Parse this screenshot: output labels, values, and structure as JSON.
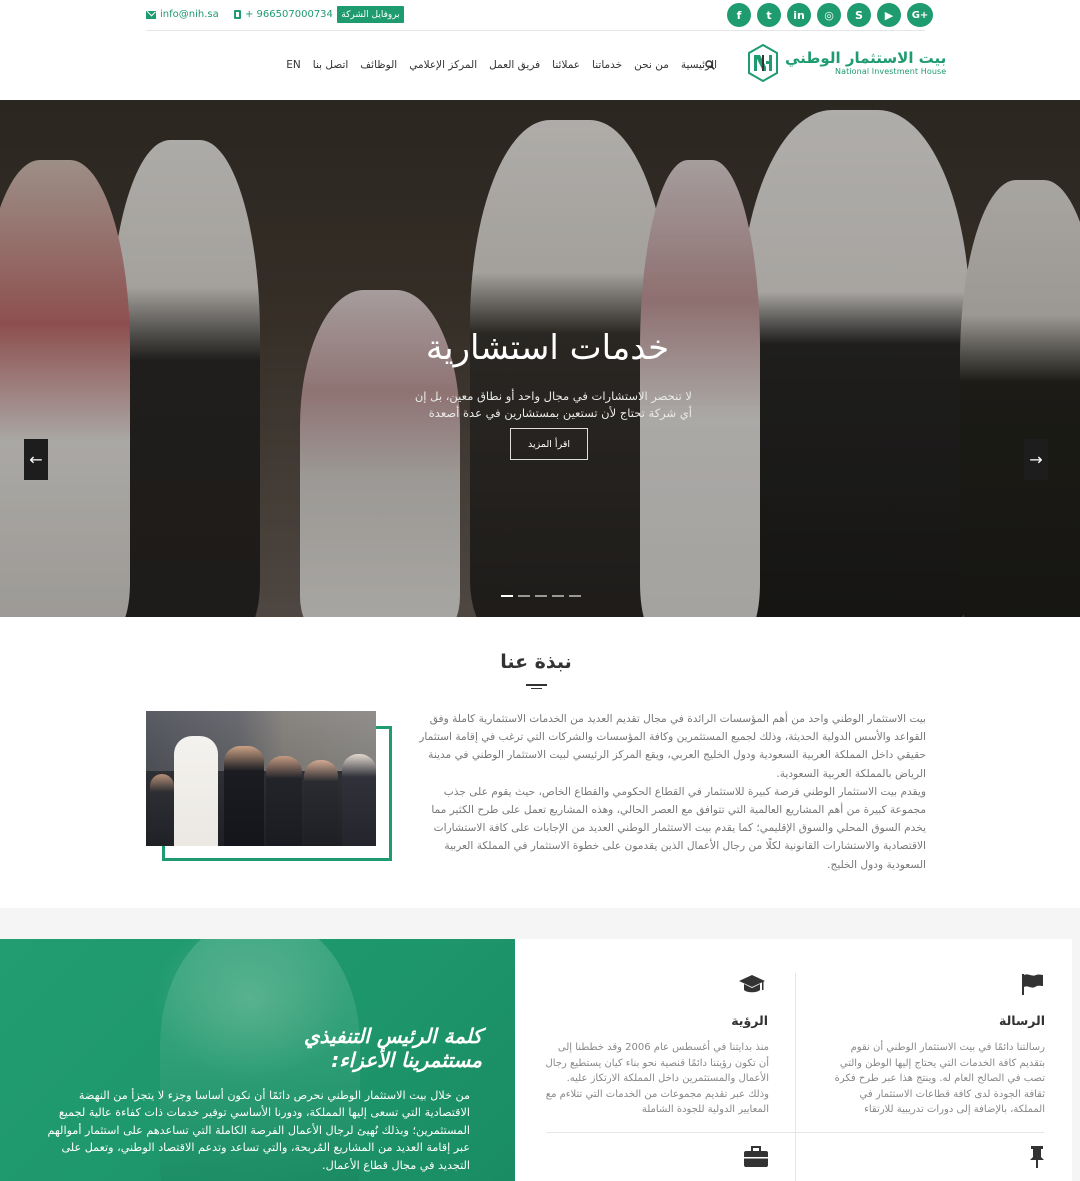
{
  "topbar": {
    "email": "info@nih.sa",
    "phone": "+ 966507000734",
    "profile_label": "بروفايل الشركة",
    "social": [
      {
        "name": "google-plus-icon",
        "glyph": "G+"
      },
      {
        "name": "youtube-icon",
        "glyph": "▶"
      },
      {
        "name": "skype-icon",
        "glyph": "S"
      },
      {
        "name": "instagram-icon",
        "glyph": "◎"
      },
      {
        "name": "linkedin-icon",
        "glyph": "in"
      },
      {
        "name": "twitter-icon",
        "glyph": "t"
      },
      {
        "name": "facebook-icon",
        "glyph": "f"
      }
    ]
  },
  "nav": {
    "logo_ar": "بيت الاستثمار الوطني",
    "logo_en": "National Investment House",
    "items": [
      "الرئيسية",
      "من نحن",
      "خدماتنا",
      "عملائنا",
      "فريق العمل",
      "المركز الإعلامي",
      "الوظائف",
      "اتصل بنا",
      "EN"
    ]
  },
  "hero": {
    "title": "خدمات استشارية",
    "subtitle": "لا تنحصر الاستشارات في مجال واحد أو نطاق معين، بل إن أي شركة تحتاج لأن تستعين بمستشارين في عدة أصعدة",
    "button": "اقرأ المزيد",
    "prev_glyph": "←",
    "next_glyph": "→",
    "slide_count": 5,
    "active_slide": 1
  },
  "about": {
    "title": "نبذة عنا",
    "paragraph1": "بيت الاستثمار الوطني واحد من أهم المؤسسات الرائدة في مجال تقديم العديد من الخدمات الاستثمارية كاملة وفق القواعد والأسس الدولية الحديثة، وذلك لجميع المستثمرين وكافة المؤسسات والشركات التي ترغب في إقامة استثمار حقيقي داخل المملكة العربية السعودية ودول الخليج العربي، ويقع المركز الرئيسي لبيت الاستثمار الوطني في مدينة الرياض بالمملكة العربية السعودية.",
    "paragraph2": "ويقدم بيت الاستثمار الوطني فرصة كبيرة للاستثمار في القطاع الحكومي والقطاع الخاص، حيث يقوم على جذب مجموعة كبيرة من أهم المشاريع العالمية التي تتوافق مع العصر الحالي، وهذه المشاريع تعمل على طرح الكثير مما يخدم السوق المحلي والسوق الإقليمي؛ كما يقدم بيت الاستثمار الوطني العديد من الإجابات على كافة الاستشارات الاقتصادية والاستشارات القانونية لكلًا من رجال الأعمال الذين يقدمون على خطوة الاستثمار في المملكة العربية السعودية ودول الخليج."
  },
  "ceo": {
    "title_line1": "كلمة الرئيس التنفيذي",
    "title_line2": "مستثمرينا الأعزاء:",
    "text": "من خلال بيت الاستثمار الوطني نحرص دائمًا أن نكون أساسا وجزء لا يتجزأ من النهضة الاقتصادية التي تسعى إليها المملكة، ودورنا الأساسي توفير خدمات ذات كفاءة عالية لجميع المستثمرين؛ وبذلك نُهيئ لرجال الأعمال الفرصة الكاملة التي تساعدهم على استثمار أموالهم عبر إقامة العديد من المشاريع المُربحة، والتي تساعد وتدعم الاقتصاد الوطني، وتعمل على التجديد في مجال قطاع الأعمال."
  },
  "cards": [
    {
      "icon": "flag-icon",
      "title": "الرسالة",
      "text": "رسالتنا دائمًا في بيت الاستثمار الوطني أن نقوم بتقديم كافة الخدمات التي يحتاج إليها الوطن والتي تصب في الصالح العام له. وينتج هذا عبر طرح فكرة ثقافة الجودة لدى كافة قطاعات الاستثمار في المملكة، بالإضافة إلى دورات تدريبية للارتقاء"
    },
    {
      "icon": "graduation-cap-icon",
      "title": "الرؤية",
      "text": "منذ بدايتنا في أغسطس عام 2006 وقد خططنا إلى أن تكون رؤيتنا دائمًا قنصية نحو بناء كيان يستطيع رجال الأعمال والمستثمرين داخل المملكة الارتكاز عليه. وذلك عبر تقديم مجموعات من الخدمات التي تتلاءم مع المعايير الدولية للجودة الشاملة"
    },
    {
      "icon": "pushpin-icon",
      "title": "",
      "text": ""
    },
    {
      "icon": "briefcase-icon",
      "title": "",
      "text": ""
    }
  ],
  "colors": {
    "accent": "#1e9b6f",
    "dark": "#333333"
  }
}
